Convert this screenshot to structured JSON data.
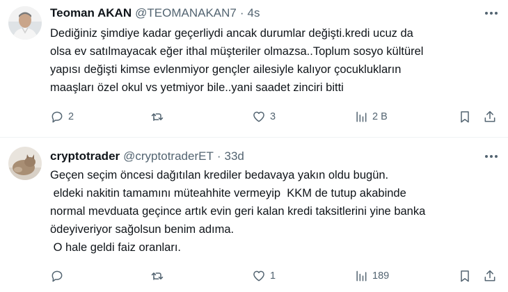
{
  "tweets": [
    {
      "display_name": "Teoman AKAN",
      "handle": "@TEOMANAKAN7",
      "separator": "·",
      "time": "4s",
      "lines": [
        "Dediğiniz şimdiye kadar geçerliydi ancak durumlar değişti.kredi ucuz da",
        "olsa ev satılmayacak eğer ithal müşteriler olmazsa..Toplum sosyo kültürel",
        "yapısı değişti kimse evlenmiyor gençler ailesiyle kalıyor çocuklukların",
        "maaşları özel okul vs yetmiyor bile..yani saadet zinciri bitti"
      ],
      "replies": "2",
      "retweets": "",
      "likes": "3",
      "views": "2 B"
    },
    {
      "display_name": "cryptotrader",
      "handle": "@cryptotraderET",
      "separator": "·",
      "time": "33d",
      "lines": [
        "Geçen seçim öncesi dağıtılan krediler bedavaya yakın oldu bugün.",
        " eldeki nakitin tamamını müteahhite vermeyip  KKM de tutup akabinde",
        "normal mevduata geçince artık evin geri kalan kredi taksitlerini yine banka",
        "ödeyiveriyor sağolsun benim adıma.",
        " O hale geldi faiz oranları."
      ],
      "replies": "",
      "retweets": "",
      "likes": "1",
      "views": "189"
    }
  ],
  "icons": {
    "reply": "speech-bubble",
    "retweet": "repost-arrows",
    "like": "heart",
    "views": "bar-chart",
    "bookmark": "bookmark",
    "share": "share-arrow",
    "more": "ellipsis"
  },
  "colors": {
    "text": "#0f1419",
    "secondary": "#536471",
    "divider": "#eff3f4"
  }
}
